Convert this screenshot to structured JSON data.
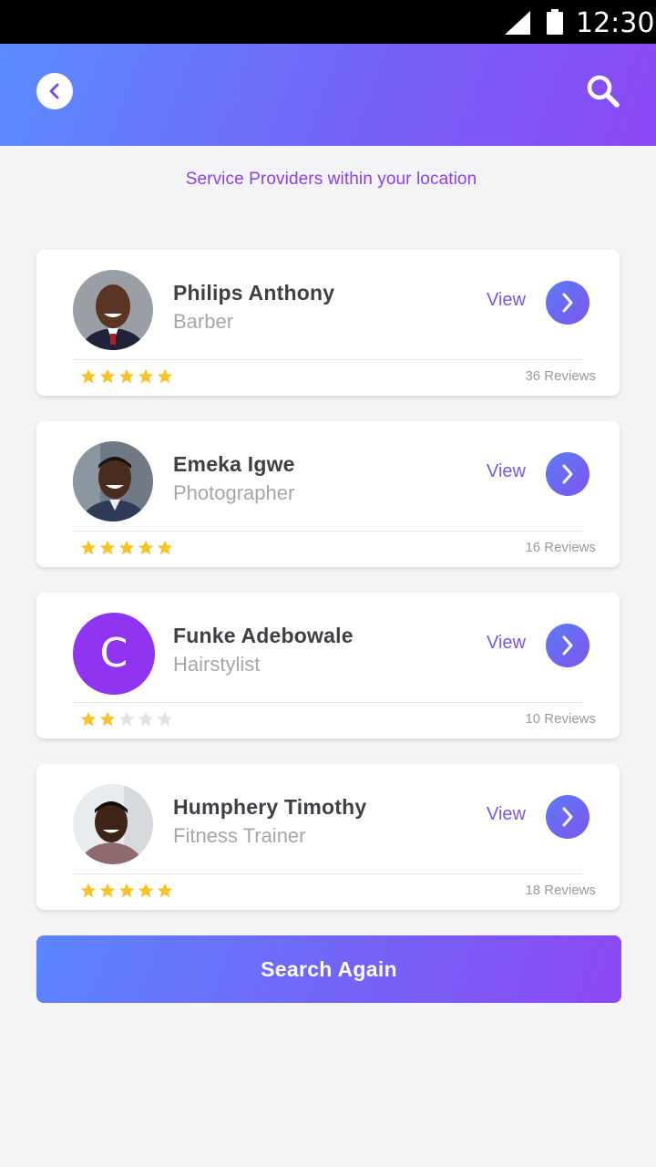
{
  "statusbar": {
    "time": "12:30",
    "signal_icon": "signal-icon",
    "battery_icon": "battery-icon"
  },
  "header": {
    "back_icon": "chevron-left-icon",
    "search_icon": "search-icon"
  },
  "subtitle": "Service Providers within your location",
  "providers": [
    {
      "name": "Philips Anthony",
      "role": "Barber",
      "view_label": "View",
      "reviews": "36 Reviews",
      "rating": 5,
      "avatar": "photo"
    },
    {
      "name": "Emeka Igwe",
      "role": "Photographer",
      "view_label": "View",
      "reviews": "16 Reviews",
      "rating": 5,
      "avatar": "photo"
    },
    {
      "name": "Funke Adebowale",
      "role": "Hairstylist",
      "view_label": "View",
      "reviews": "10 Reviews",
      "rating": 2,
      "avatar_letter": "C"
    },
    {
      "name": "Humphery Timothy",
      "role": "Fitness Trainer",
      "view_label": "View",
      "reviews": "18 Reviews",
      "rating": 5,
      "avatar": "photo"
    }
  ],
  "rating_max": 5,
  "search_again_label": "Search Again",
  "colors": {
    "accent": "#7a55e8",
    "star_filled": "#f7c325",
    "star_empty": "#e2e2e6",
    "header_start": "#5b8cff",
    "header_end": "#8c48f5",
    "letter_avatar": "#8f34f0"
  }
}
